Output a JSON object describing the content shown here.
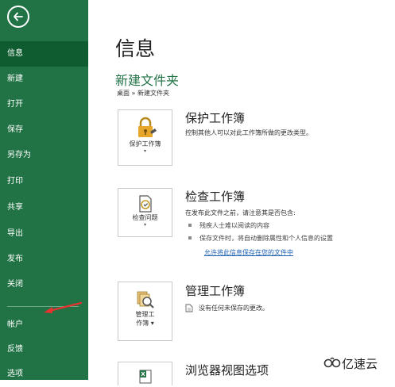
{
  "sidebar": {
    "items": [
      {
        "label": "信息",
        "active": true
      },
      {
        "label": "新建"
      },
      {
        "label": "打开"
      },
      {
        "label": "保存"
      },
      {
        "label": "另存为"
      },
      {
        "label": "打印"
      },
      {
        "label": "共享"
      },
      {
        "label": "导出"
      },
      {
        "label": "发布"
      },
      {
        "label": "关闭"
      },
      {
        "label": "帐户"
      },
      {
        "label": "反馈"
      },
      {
        "label": "选项"
      }
    ]
  },
  "main": {
    "title": "信息",
    "folder": "新建文件夹",
    "breadcrumb": "桌面 » 新建文件夹",
    "sections": [
      {
        "button_label": "保护工作簿",
        "title": "保护工作簿",
        "description": "控制其他人可以对此工作簿所做的更改类型。",
        "icon": "lock-icon"
      },
      {
        "button_label": "检查问题",
        "title": "检查工作簿",
        "description": "在发布此文件之前，请注意其是否包含:",
        "bullets": [
          "残疾人士难以阅读的内容",
          "保存文件时，将自动删除属性和个人信息的设置"
        ],
        "link": "允许将此信息保存在您的文件中",
        "icon": "inspect-icon"
      },
      {
        "button_label_1": "管理工",
        "button_label_2": "作簿",
        "title": "管理工作簿",
        "description": "没有任何未保存的更改。",
        "icon": "manage-icon"
      },
      {
        "title": "浏览器视图选项",
        "icon": "excel-browser-icon"
      }
    ]
  },
  "watermark": "亿速云",
  "colors": {
    "sidebar": "#217346",
    "active": "#0e5c30",
    "accent": "#217346",
    "link": "#1a5fb4"
  }
}
